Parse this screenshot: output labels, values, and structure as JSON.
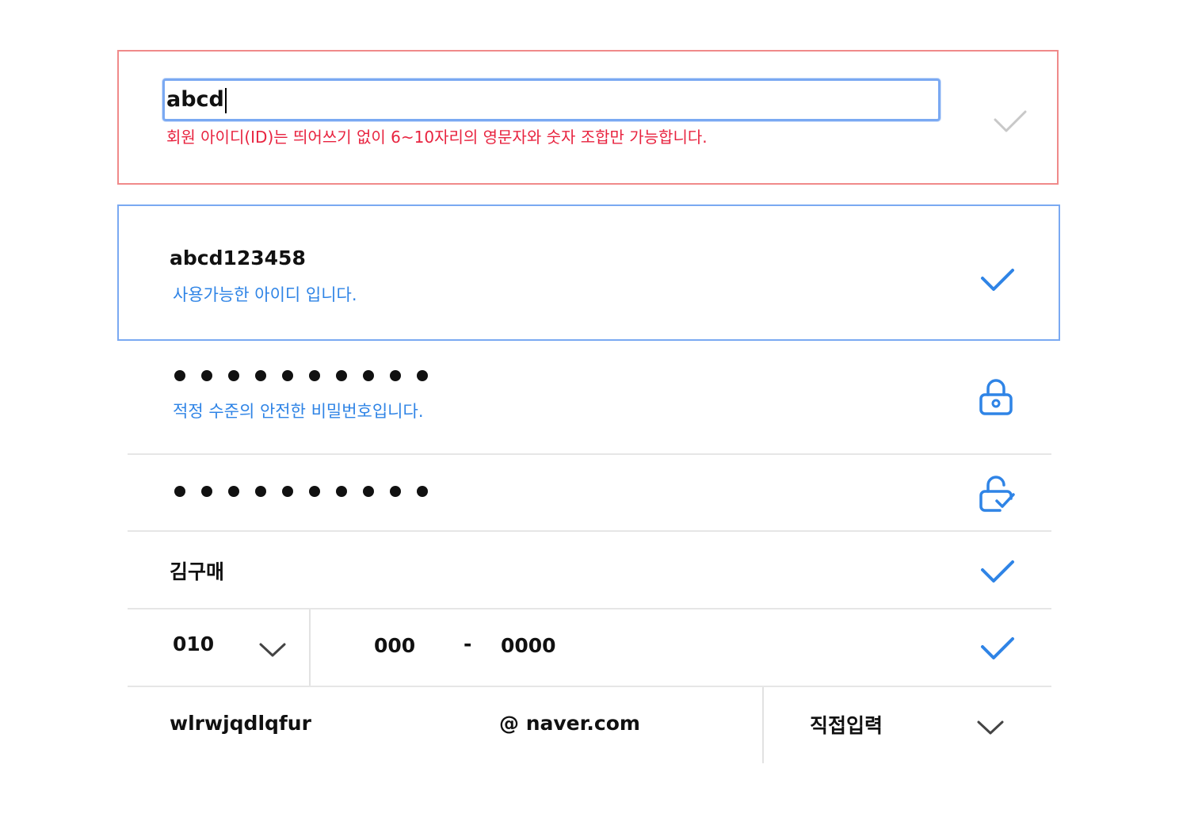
{
  "user_id_error": {
    "value": "abcd",
    "message": "회원 아이디(ID)는 띄어쓰기 없이 6~10자리의 영문자와 숫자 조합만 가능합니다."
  },
  "user_id_ok": {
    "value": "abcd123458",
    "message": "사용가능한 아이디 입니다."
  },
  "password": {
    "masked_length": 10,
    "message": "적정 수준의 안전한 비밀번호입니다."
  },
  "password_confirm": {
    "masked_length": 10
  },
  "name": {
    "value": "김구매"
  },
  "phone": {
    "prefix": "010",
    "middle": "000",
    "separator": "-",
    "last": "0000"
  },
  "email": {
    "local": "wlrwjqdlqfur",
    "domain": "@ naver.com",
    "domain_select": "직접입력"
  },
  "colors": {
    "error": "#e8233f",
    "accent": "#2f84e6",
    "error_border": "#f08a8a",
    "focus_border": "#7aa9f2",
    "check_inactive": "#c8c8c8"
  },
  "icons": {
    "valid": "check-icon",
    "password": "lock-icon",
    "password_confirm": "lock-check-icon",
    "dropdown": "chevron-down-icon"
  }
}
